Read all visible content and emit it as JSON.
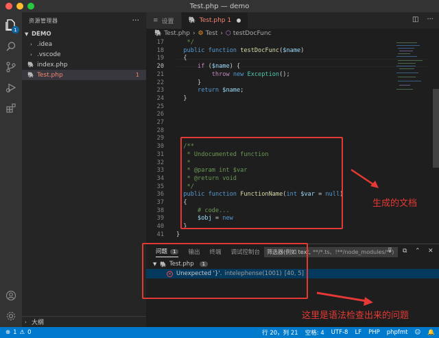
{
  "window": {
    "title": "Test.php — demo"
  },
  "activity": {
    "badge": "1"
  },
  "sidebar": {
    "header": "资源管理器",
    "more": "···",
    "folder": "DEMO",
    "items": [
      {
        "label": ".idea"
      },
      {
        "label": ".vscode"
      },
      {
        "label": "index.php"
      },
      {
        "label": "Test.php",
        "count": "1"
      }
    ],
    "outline": "大纲"
  },
  "tabs": [
    {
      "label": "设置"
    },
    {
      "label": "Test.php 1"
    }
  ],
  "breadcrumb": [
    "Test.php",
    "Test",
    "testDocFunc"
  ],
  "editor": {
    "lines": [
      {
        "n": "17",
        "code": "   */"
      },
      {
        "n": "18",
        "code": "  public function testDocFunc($name)"
      },
      {
        "n": "19",
        "code": "  {"
      },
      {
        "n": "20",
        "code": "      if ($name) {"
      },
      {
        "n": "21",
        "code": "          throw new Exception();"
      },
      {
        "n": "22",
        "code": "      }"
      },
      {
        "n": "23",
        "code": "      return $name;"
      },
      {
        "n": "24",
        "code": "  }"
      },
      {
        "n": "25",
        "code": ""
      },
      {
        "n": "26",
        "code": ""
      },
      {
        "n": "27",
        "code": ""
      },
      {
        "n": "28",
        "code": ""
      },
      {
        "n": "29",
        "code": ""
      },
      {
        "n": "30",
        "code": "  /**"
      },
      {
        "n": "31",
        "code": "   * Undocumented function"
      },
      {
        "n": "32",
        "code": "   *"
      },
      {
        "n": "33",
        "code": "   * @param int $var"
      },
      {
        "n": "34",
        "code": "   * @return void"
      },
      {
        "n": "35",
        "code": "   */"
      },
      {
        "n": "36",
        "code": "  public function FunctionName(int $var = null)"
      },
      {
        "n": "37",
        "code": "  {"
      },
      {
        "n": "38",
        "code": "      # code..."
      },
      {
        "n": "39",
        "code": "      $obj = new"
      },
      {
        "n": "40",
        "code": "  }"
      },
      {
        "n": "41",
        "code": "}"
      }
    ]
  },
  "annotations": {
    "doc": "生成的文档",
    "syntax": "这里是语法检查出来的问题"
  },
  "panel": {
    "tabs": [
      "问题",
      "输出",
      "终端",
      "调试控制台"
    ],
    "problems_count": "1",
    "filter_label": "筛选器(例如 text,",
    "filter_placeholder": "**/*.ts、!**/node_modules/**)",
    "file": "Test.php",
    "file_count": "1",
    "error_message": "Unexpected '}'.",
    "error_source": "intelephense(1001)",
    "error_pos": "[40, 5]"
  },
  "status": {
    "errors": "1",
    "warnings": "0",
    "position": "行 20，列 21",
    "indent": "空格: 4",
    "encoding": "UTF-8",
    "eol": "LF",
    "language": "PHP",
    "formatter": "phpfmt"
  }
}
